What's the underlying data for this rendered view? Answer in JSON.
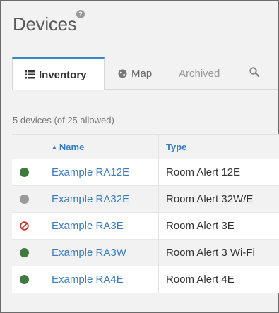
{
  "header": {
    "title": "Devices",
    "help_glyph": "?"
  },
  "tabs": [
    {
      "label": "Inventory",
      "icon": "list-icon",
      "active": true
    },
    {
      "label": "Map",
      "icon": "globe-icon",
      "active": false
    },
    {
      "label": "Archived",
      "icon": "",
      "active": false
    },
    {
      "label": "",
      "icon": "search-icon",
      "active": false
    }
  ],
  "summary": "5 devices (of 25 allowed)",
  "table": {
    "columns": [
      {
        "label": "Name",
        "sort": "ascending",
        "sort_glyph": "▲"
      },
      {
        "label": "Type"
      }
    ],
    "rows": [
      {
        "status": "online",
        "status_color": "#3f7a3f",
        "name": "Example RA12E",
        "type": "Room Alert 12E"
      },
      {
        "status": "offline",
        "status_color": "#9a9a9a",
        "name": "Example RA32E",
        "type": "Room Alert 32W/E"
      },
      {
        "status": "disabled",
        "status_color": "#c0392b",
        "name": "Example RA3E",
        "type": "Room Alert 3E"
      },
      {
        "status": "online",
        "status_color": "#3f7a3f",
        "name": "Example RA3W",
        "type": "Room Alert 3 Wi-Fi"
      },
      {
        "status": "online",
        "status_color": "#3f7a3f",
        "name": "Example RA4E",
        "type": "Room Alert 4E"
      }
    ]
  },
  "colors": {
    "accent": "#3a87c8",
    "link": "#3a7cbf"
  }
}
